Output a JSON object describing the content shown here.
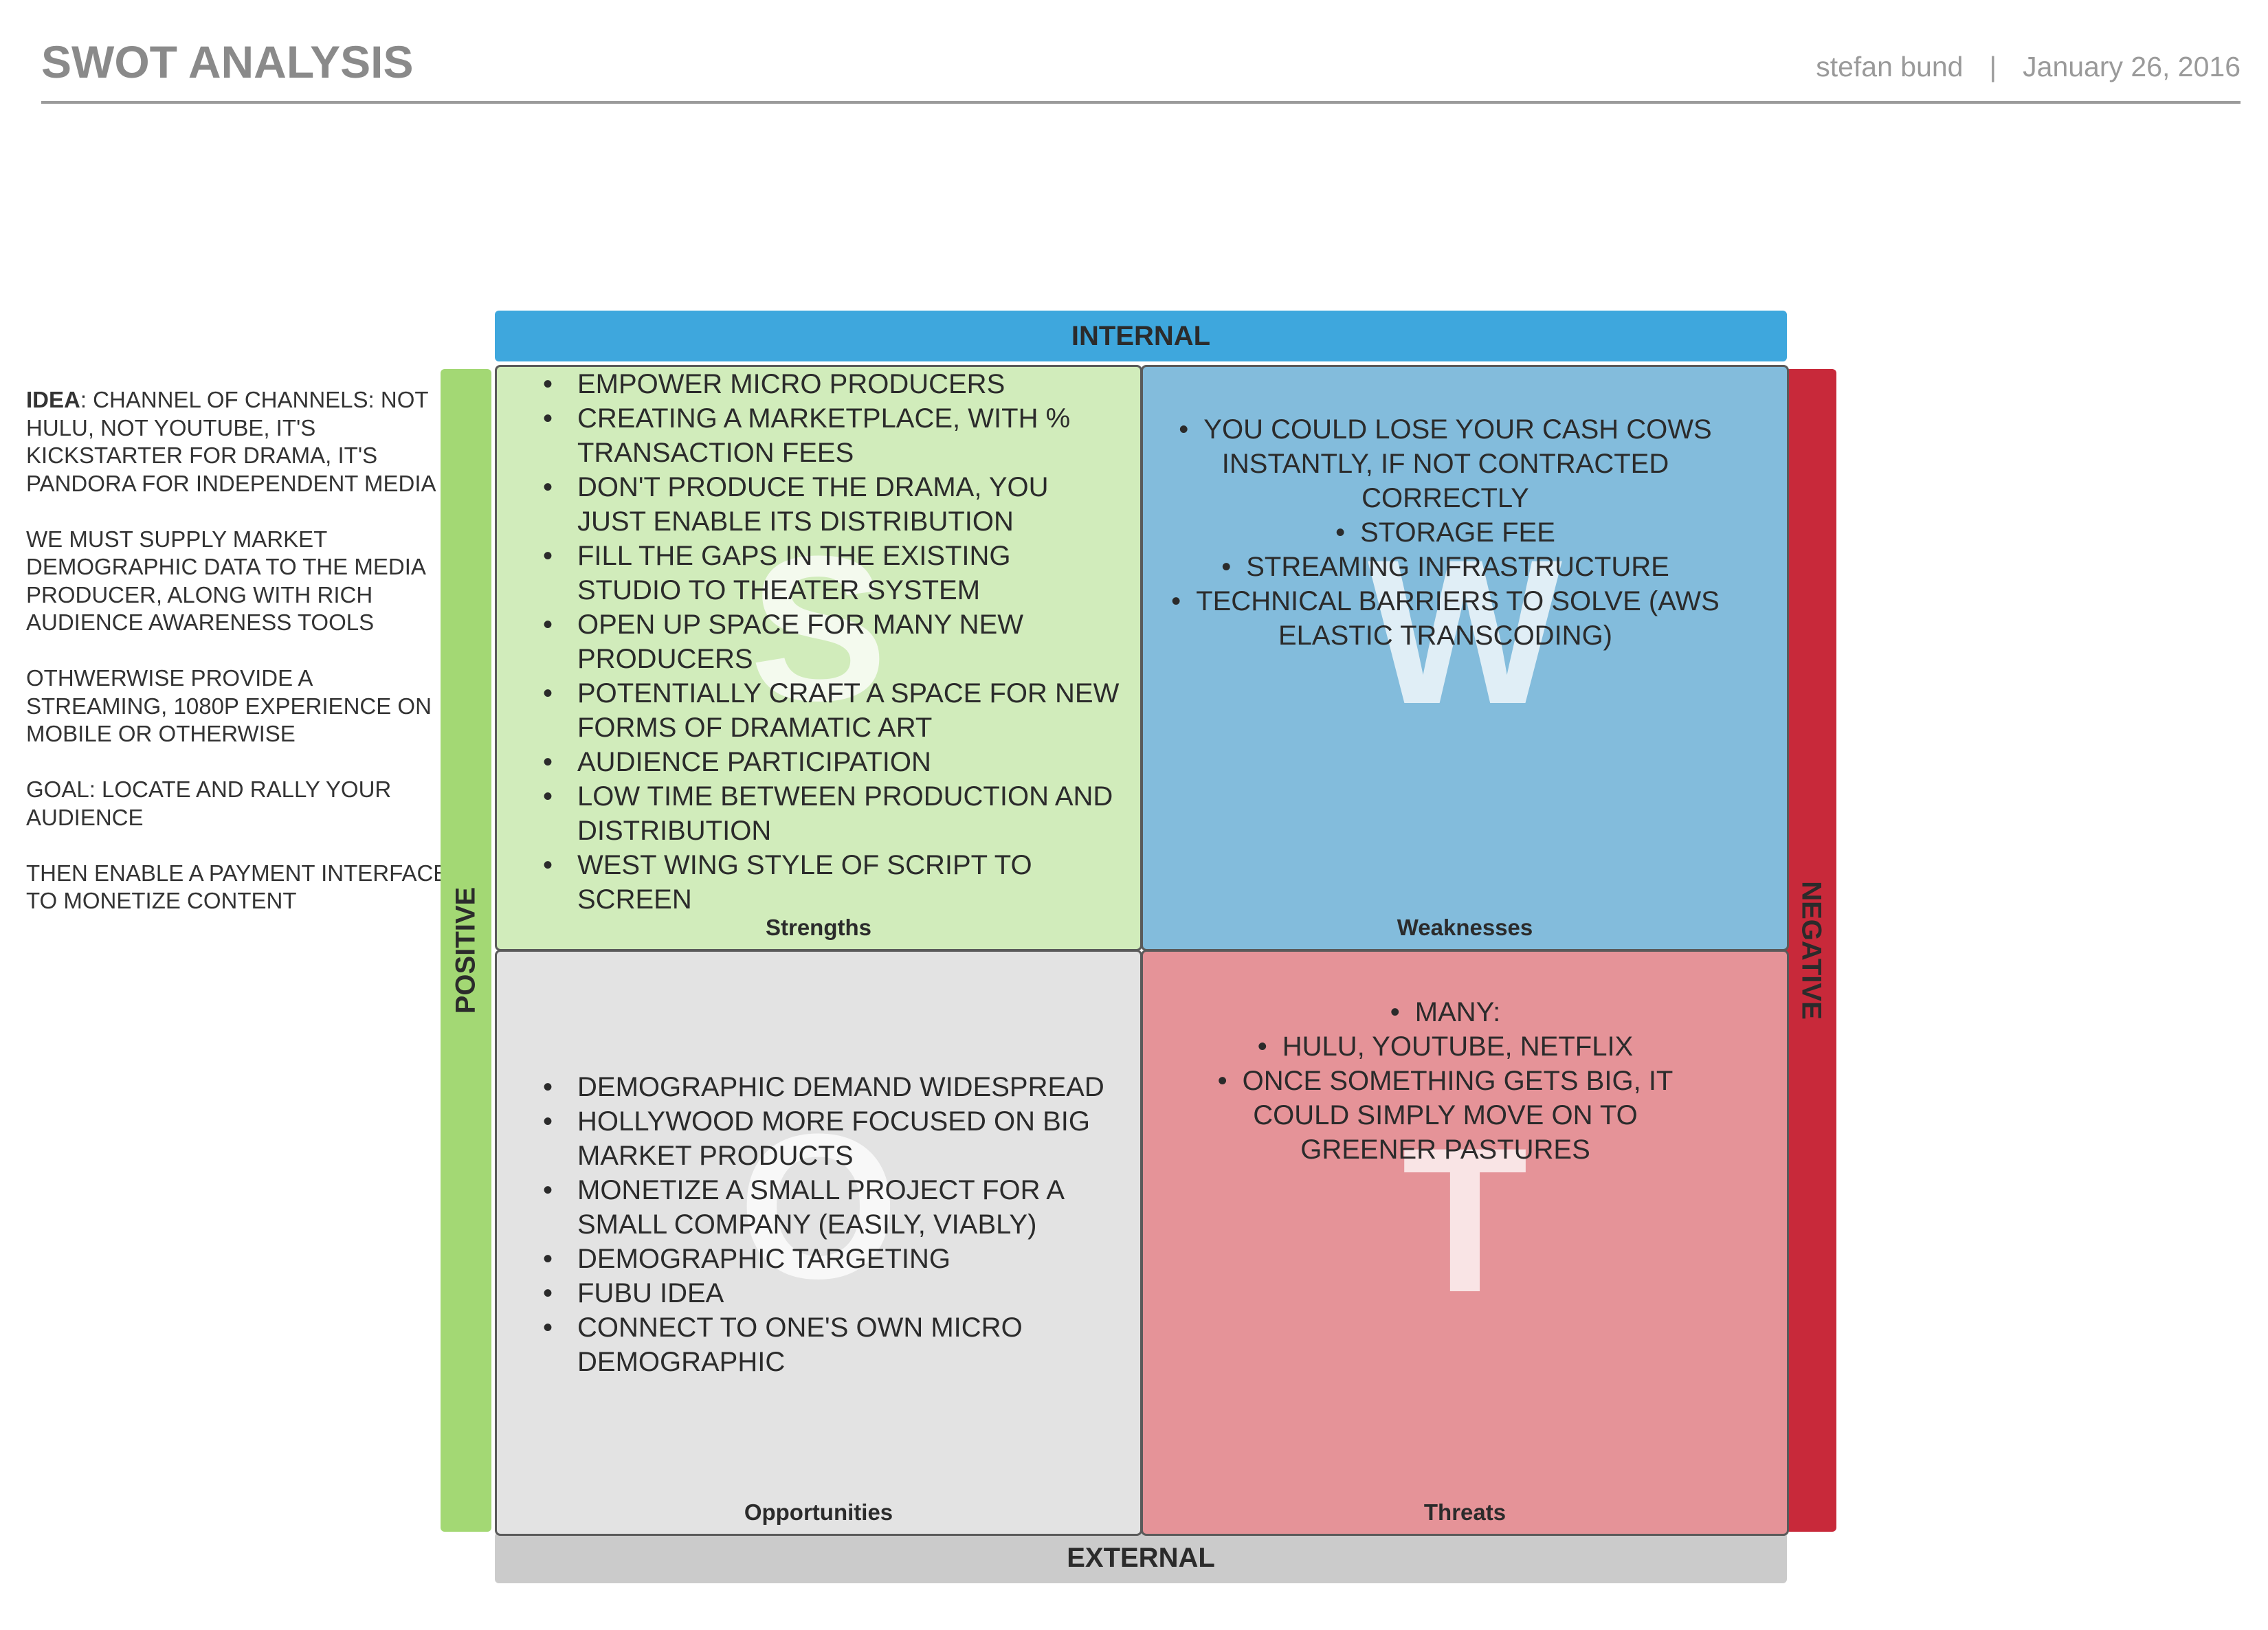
{
  "header": {
    "title": "SWOT ANALYSIS",
    "author": "stefan bund",
    "separator": "|",
    "date": "January 26, 2016"
  },
  "notes": {
    "idea_label": "IDEA",
    "idea_text": ": CHANNEL OF CHANNELS: NOT HULU, NOT YOUTUBE, IT'S KICKSTARTER FOR DRAMA, IT'S PANDORA FOR INDEPENDENT MEDIA",
    "paragraphs": [
      "WE MUST SUPPLY MARKET DEMOGRAPHIC DATA TO THE MEDIA PRODUCER, ALONG WITH RICH AUDIENCE AWARENESS TOOLS",
      "OTHWERWISE PROVIDE A STREAMING, 1080P EXPERIENCE ON MOBILE OR OTHERWISE",
      "GOAL: LOCATE AND RALLY YOUR AUDIENCE",
      "THEN ENABLE A PAYMENT INTERFACE TO MONETIZE CONTENT"
    ]
  },
  "axes": {
    "top": "INTERNAL",
    "bottom": "EXTERNAL",
    "left": "POSITIVE",
    "right": "NEGATIVE"
  },
  "colors": {
    "internal": "#3ea7dd",
    "external": "#cbcbcb",
    "positive": "#a3d874",
    "negative": "#c8293a",
    "strengths": "#d1ecbb",
    "weaknesses": "#83bcdc",
    "opportunities": "#e3e3e3",
    "threats": "#e59398"
  },
  "quadrants": {
    "strengths": {
      "letter": "S",
      "caption": "Strengths",
      "items": [
        "EMPOWER MICRO PRODUCERS",
        "CREATING A MARKETPLACE, WITH % TRANSACTION FEES",
        "DON'T PRODUCE THE DRAMA, YOU JUST ENABLE ITS DISTRIBUTION",
        "FILL THE GAPS IN THE EXISTING STUDIO TO THEATER SYSTEM",
        "OPEN UP SPACE FOR MANY NEW PRODUCERS",
        "POTENTIALLY CRAFT A SPACE FOR NEW FORMS OF DRAMATIC ART",
        "AUDIENCE PARTICIPATION",
        "LOW TIME BETWEEN PRODUCTION AND DISTRIBUTION",
        "WEST WING STYLE OF SCRIPT TO SCREEN"
      ]
    },
    "weaknesses": {
      "letter": "W",
      "caption": "Weaknesses",
      "items": [
        "YOU COULD LOSE YOUR CASH COWS INSTANTLY, IF NOT CONTRACTED CORRECTLY",
        "STORAGE FEE",
        "STREAMING INFRASTRUCTURE",
        "TECHNICAL BARRIERS TO SOLVE (AWS ELASTIC TRANSCODING)"
      ]
    },
    "opportunities": {
      "letter": "O",
      "caption": "Opportunities",
      "items": [
        "DEMOGRAPHIC DEMAND WIDESPREAD",
        "HOLLYWOOD MORE FOCUSED ON BIG MARKET PRODUCTS",
        "MONETIZE A SMALL PROJECT FOR A SMALL COMPANY (EASILY, VIABLY)",
        "DEMOGRAPHIC TARGETING",
        "FUBU IDEA",
        "CONNECT TO ONE'S OWN MICRO DEMOGRAPHIC"
      ]
    },
    "threats": {
      "letter": "T",
      "caption": "Threats",
      "items": [
        "MANY:",
        "HULU, YOUTUBE, NETFLIX",
        "ONCE SOMETHING GETS BIG, IT COULD SIMPLY MOVE ON TO GREENER PASTURES"
      ]
    }
  }
}
